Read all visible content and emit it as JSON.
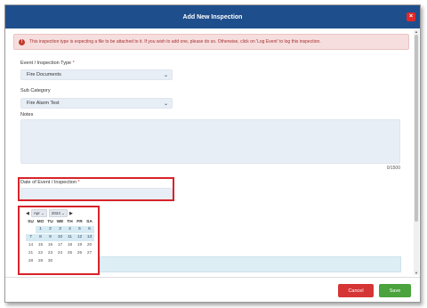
{
  "dialog": {
    "title": "Add New Inspection",
    "close_icon": "×"
  },
  "alert": {
    "icon": "!",
    "message": "This inspection type is expecting a file to be attached to it. If you wish to add one, please do so. Otherwise, click on 'Log Event' to log this inspection."
  },
  "form": {
    "event_type_label": "Event / Inspection Type",
    "event_type_required": "*",
    "event_type_value": "Fire Documents",
    "sub_category_label": "Sub Category",
    "sub_category_value": "Fire Alarm Test",
    "notes_label": "Notes",
    "notes_counter": "0/1500",
    "date_label": "Date of Event / Inspection",
    "date_required": "*"
  },
  "calendar": {
    "prev_icon": "◀",
    "next_icon": "▶",
    "month": "Apr",
    "year": "2024",
    "weekdays": [
      "SU",
      "MO",
      "TU",
      "WE",
      "TH",
      "FR",
      "SA"
    ],
    "weeks": [
      [
        "",
        "1",
        "2",
        "3",
        "4",
        "5",
        "6"
      ],
      [
        "7",
        "8",
        "9",
        "10",
        "11",
        "12",
        "13"
      ],
      [
        "14",
        "15",
        "16",
        "17",
        "18",
        "19",
        "20"
      ],
      [
        "21",
        "22",
        "23",
        "24",
        "25",
        "26",
        "27"
      ],
      [
        "28",
        "29",
        "30",
        "",
        "",
        "",
        ""
      ]
    ]
  },
  "footer": {
    "cancel_label": "Cancel",
    "save_label": "Save"
  },
  "colors": {
    "header": "#1f4e8c",
    "cancel": "#d63535",
    "save": "#4aa33c",
    "highlight_box": "#d8232a"
  }
}
